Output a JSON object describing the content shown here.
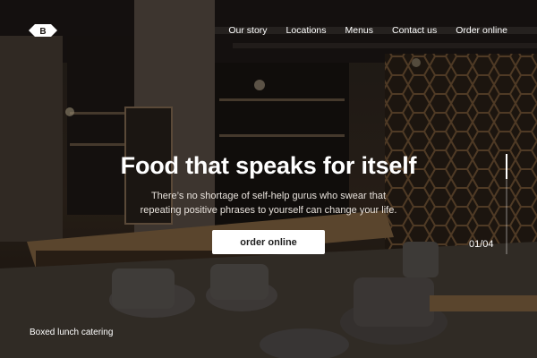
{
  "nav": {
    "items": [
      "Our story",
      "Locations",
      "Menus",
      "Contact us",
      "Order online"
    ]
  },
  "logo": {
    "letter": "B"
  },
  "hero": {
    "headline": "Food that speaks for itself",
    "subtext": "There’s no shortage of self-help gurus who swear that repeating positive phrases to yourself can change your life.",
    "cta_label": "order online"
  },
  "slider": {
    "counter": "01/04",
    "current": 1,
    "total": 4,
    "progress": 0.25
  },
  "caption": "Boxed lunch catering",
  "colors": {
    "text": "#ffffff",
    "button_bg": "#ffffff",
    "button_text": "#1d1d1d"
  }
}
